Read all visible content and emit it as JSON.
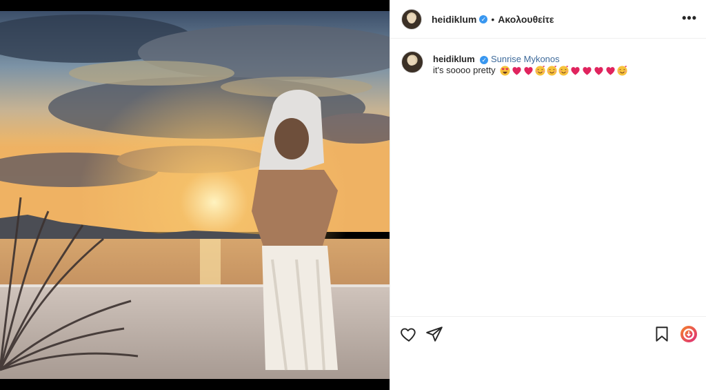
{
  "post": {
    "username": "heidiklum",
    "verified_mark": "✓",
    "separator": "•",
    "follow_status": "Ακολουθείτε",
    "more_label": "•••"
  },
  "caption": {
    "username": "heidiklum",
    "verified_mark": "✓",
    "title": "Sunrise Mykonos",
    "text": "it's soooo pretty",
    "emojis": [
      "heart-eyes",
      "red-heart",
      "red-heart",
      "smiling-hearts",
      "smiling-hearts",
      "smiling-hearts",
      "red-heart",
      "red-heart",
      "red-heart",
      "red-heart",
      "smiling-hearts"
    ]
  },
  "actions": {
    "like_icon": "heart-icon",
    "share_icon": "paper-plane-icon",
    "save_icon": "bookmark-icon",
    "extra_icon": "download-badge-icon"
  },
  "colors": {
    "verified_blue": "#3897f0",
    "link_blue": "#3e6a9a",
    "heart_red": "#e0245e",
    "badge_gradient_start": "#f58529",
    "badge_gradient_end": "#dd2a7b"
  }
}
